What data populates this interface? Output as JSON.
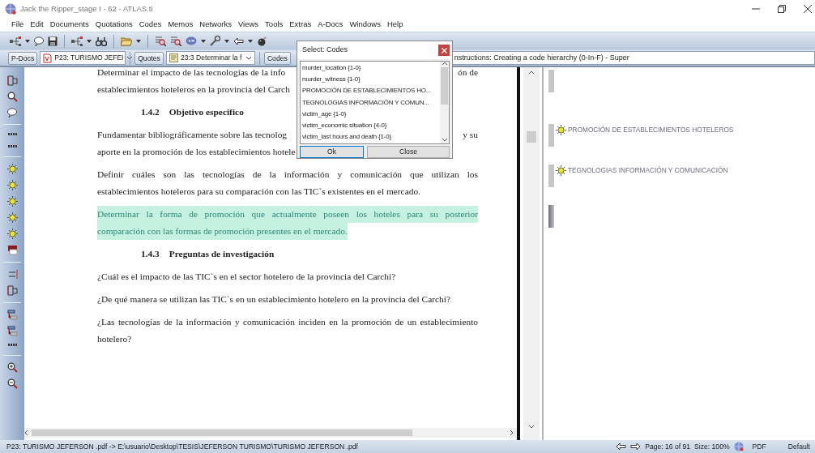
{
  "window": {
    "title": "Jack the Ripper_stage I - 62 - ATLAS.ti"
  },
  "menu": [
    "File",
    "Edit",
    "Documents",
    "Quotations",
    "Codes",
    "Memos",
    "Networks",
    "Views",
    "Tools",
    "Extras",
    "A-Docs",
    "Windows",
    "Help"
  ],
  "toolbar": {
    "pdocs_button": "P-Docs",
    "document_dropdown": "P23: TURISMO JEFEI",
    "quotes_button": "Quotes",
    "quote_dropdown": "23:3 Determinar la f",
    "codes_button": "Codes",
    "memo_dropdown": "nstructions: Creating a code hierarchy (0-In-F) - Super"
  },
  "document": {
    "paragraphs": [
      {
        "kind": "text",
        "highlighted": false,
        "lines": [
          {
            "text": "Determinar el impacto de las tecnologías de la info",
            "tail": "ón de"
          },
          {
            "text": "establecimientos hoteleros en la provincia del Carch"
          }
        ]
      },
      {
        "kind": "heading",
        "number": "1.4.2",
        "title": "Objetivo especifico"
      },
      {
        "kind": "text",
        "highlighted": false,
        "lines": [
          {
            "text": "Fundamentar bibliográficamente sobre las tecnolog",
            "tail": "y su"
          },
          {
            "text": "aporte en la promoción de los establecimientos hotele"
          }
        ]
      },
      {
        "kind": "text",
        "highlighted": false,
        "lines": [
          {
            "text": "Definir cuáles son las tecnologías de la información y comunicación que utilizan los"
          },
          {
            "text": "establecimientos hoteleros para su comparación con las TIC`s existentes en el mercado."
          }
        ]
      },
      {
        "kind": "text",
        "highlighted": true,
        "lines": [
          {
            "text": "Determinar la forma de promoción que actualmente poseen los hoteles para su posterior"
          },
          {
            "text": "comparación con las formas de promoción presentes en el mercado."
          }
        ]
      },
      {
        "kind": "heading",
        "number": "1.4.3",
        "title": "Preguntas de investigación"
      },
      {
        "kind": "text",
        "highlighted": false,
        "lines": [
          {
            "text": "¿Cuál es el impacto de las TIC`s en el sector hotelero de la provincia del Carchi?"
          }
        ]
      },
      {
        "kind": "text",
        "highlighted": false,
        "lines": [
          {
            "text": "¿De qué manera se utilizan las TIC`s en un establecimiento hotelero en la provincia del Carchi?"
          }
        ]
      },
      {
        "kind": "text",
        "highlighted": false,
        "lines": [
          {
            "text": "¿Las tecnologías de la información y comunicación inciden en la promoción de un establecimiento"
          },
          {
            "text": "hotelero?"
          }
        ]
      }
    ]
  },
  "margin": {
    "codes": [
      {
        "selected": false
      },
      {
        "label": "PROMOCIÓN DE ESTABLECIMIENTOS HOTELEROS",
        "selected": false
      },
      {
        "label": "TEGNOLOGIAS INFORMACIÓN Y COMUNICACIÓN",
        "selected": false
      },
      {
        "selected": true
      }
    ]
  },
  "dialog": {
    "title": "Select: Codes",
    "items": [
      {
        "label": "murder_location {1-0}"
      },
      {
        "label": "murder_witness {1-0}"
      },
      {
        "label": "PROMOCIÓN DE ESTABLECIMIENTOS HO..."
      },
      {
        "label": "TEGNOLOGIAS INFORMACIÓN Y COMUN..."
      },
      {
        "label": "victim_age {1-0}"
      },
      {
        "label": "victim_economic situation {4-0}"
      },
      {
        "label": "victim_last hours and death {1-0}"
      }
    ],
    "buttons": [
      {
        "label": "Ok",
        "focused": true
      },
      {
        "label": "Close",
        "focused": false
      }
    ]
  },
  "status_bar": {
    "path": "P23: TURISMO JEFERSON .pdf -> E:\\usuario\\Desktop\\TESIS\\JEFERSON TURISMO\\TURISMO JEFERSON .pdf",
    "page": "Page: 16 of 91",
    "size": "Size: 100%",
    "format": "PDF",
    "layout": "Default"
  }
}
